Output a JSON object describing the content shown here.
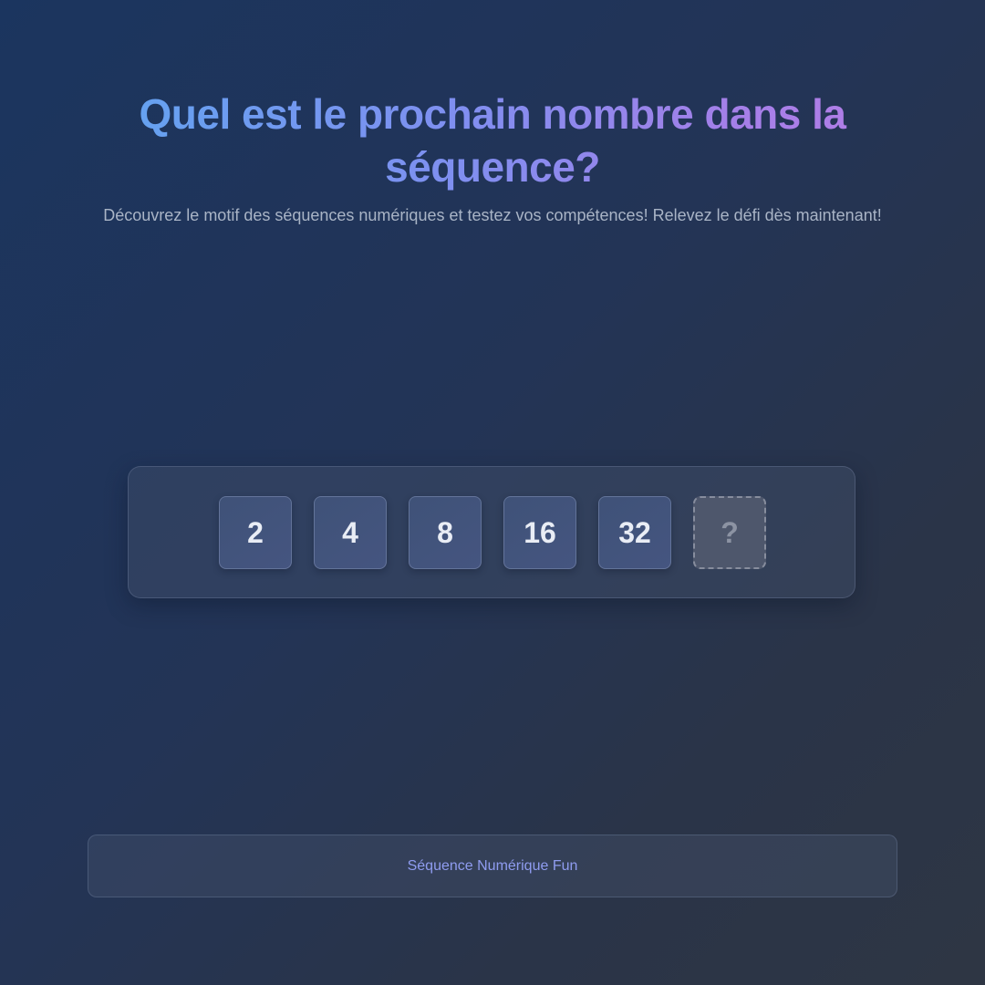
{
  "header": {
    "title": "Quel est le prochain nombre dans la séquence?",
    "subtitle": "Découvrez le motif des séquences numériques et testez vos compétences! Relevez le défi dès maintenant!"
  },
  "sequence": {
    "numbers": [
      "2",
      "4",
      "8",
      "16",
      "32"
    ],
    "unknown": "?"
  },
  "footer": {
    "text": "Séquence Numérique Fun"
  },
  "colors": {
    "title_gradient_start": "#62a4f0",
    "title_gradient_end": "#b37ee6",
    "footer_text": "#8f9cf0"
  }
}
